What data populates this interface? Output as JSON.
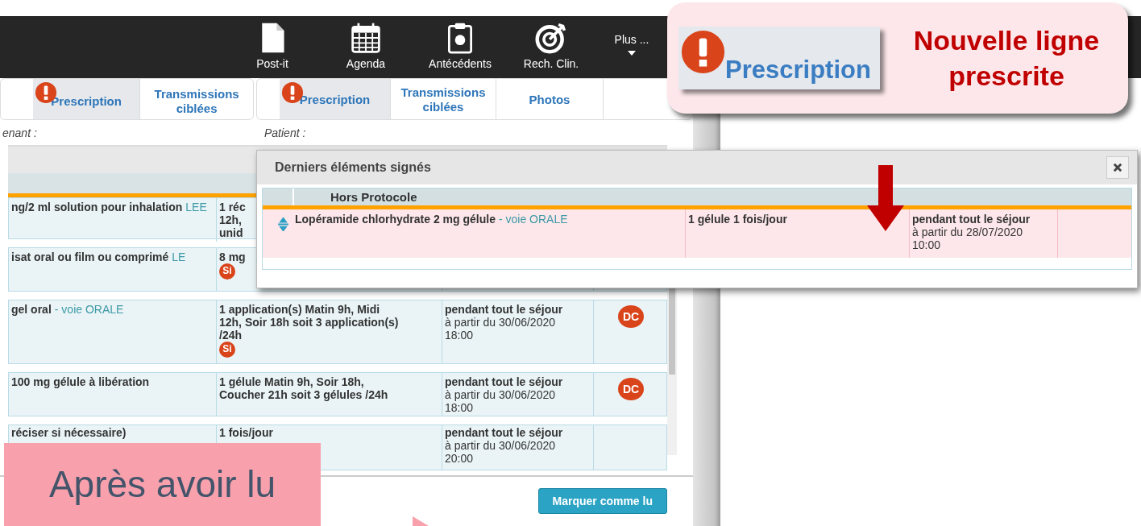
{
  "toolbar": [
    {
      "label": "Post-it",
      "kind": "button"
    },
    {
      "label": "Agenda",
      "kind": "button"
    },
    {
      "label": "Antécédents",
      "kind": "button"
    },
    {
      "label": "Rech. Clin.",
      "kind": "button"
    },
    {
      "label": "Plus ...",
      "kind": "menu"
    }
  ],
  "left_panel": {
    "tabs": [
      {
        "label": "Prescription",
        "alert": true,
        "selected": true
      },
      {
        "label": "Transmissions ciblées",
        "alert": false,
        "selected": false
      }
    ],
    "field_label": "enant :"
  },
  "right_panel": {
    "tabs": [
      {
        "label": "Prescription",
        "alert": true,
        "selected": true
      },
      {
        "label": "Transmissions ciblées",
        "alert": false,
        "selected": false
      },
      {
        "label": "Photos",
        "alert": false,
        "selected": false
      }
    ],
    "field_label": "Patient :"
  },
  "table": {
    "rows": [
      {
        "drug": "ng/2 ml solution pour inhalation",
        "route": "LEE",
        "dosage": "1 réc\n12h,\nunid"
      },
      {
        "drug": "isat oral ou film ou comprimé",
        "route": "LE",
        "dosage": "8 mg",
        "badge": "Si"
      },
      {
        "drug": "gel oral",
        "route": "- voie ORALE",
        "dosage": "1 application(s) Matin 9h, Midi\n12h, Soir 18h soit 3 application(s)\n/24h",
        "badge": "Si",
        "duration": "pendant tout le séjour",
        "start": "à partir du 30/06/2020\n18:00",
        "stop": "DC"
      },
      {
        "drug": "100 mg gélule à libération",
        "dosage": "1 gélule Matin 9h, Soir 18h,\nCoucher 21h soit 3 gélules /24h",
        "duration": "pendant tout le séjour",
        "start": "à partir du 30/06/2020\n18:00",
        "stop": "DC"
      },
      {
        "drug": "réciser si nécessaire)",
        "dosage": "1 fois/jour",
        "duration": "pendant tout le séjour",
        "start": "à partir du 30/06/2020\n20:00"
      }
    ]
  },
  "footer": {
    "button": "Marquer comme lu"
  },
  "dialog": {
    "title": "Derniers éléments signés",
    "group": "Hors Protocole",
    "rows": [
      {
        "drug": "Lopéramide chlorhydrate 2 mg gélule",
        "route": "- voie ORALE",
        "dosage": "1 gélule 1 fois/jour",
        "duration": "pendant tout le séjour",
        "start": "à partir du 28/07/2020\n10:00"
      }
    ]
  },
  "callout": {
    "tab_label": "Prescription",
    "text": "Nouvelle ligne prescrite"
  },
  "note": {
    "text": "Après avoir lu"
  }
}
